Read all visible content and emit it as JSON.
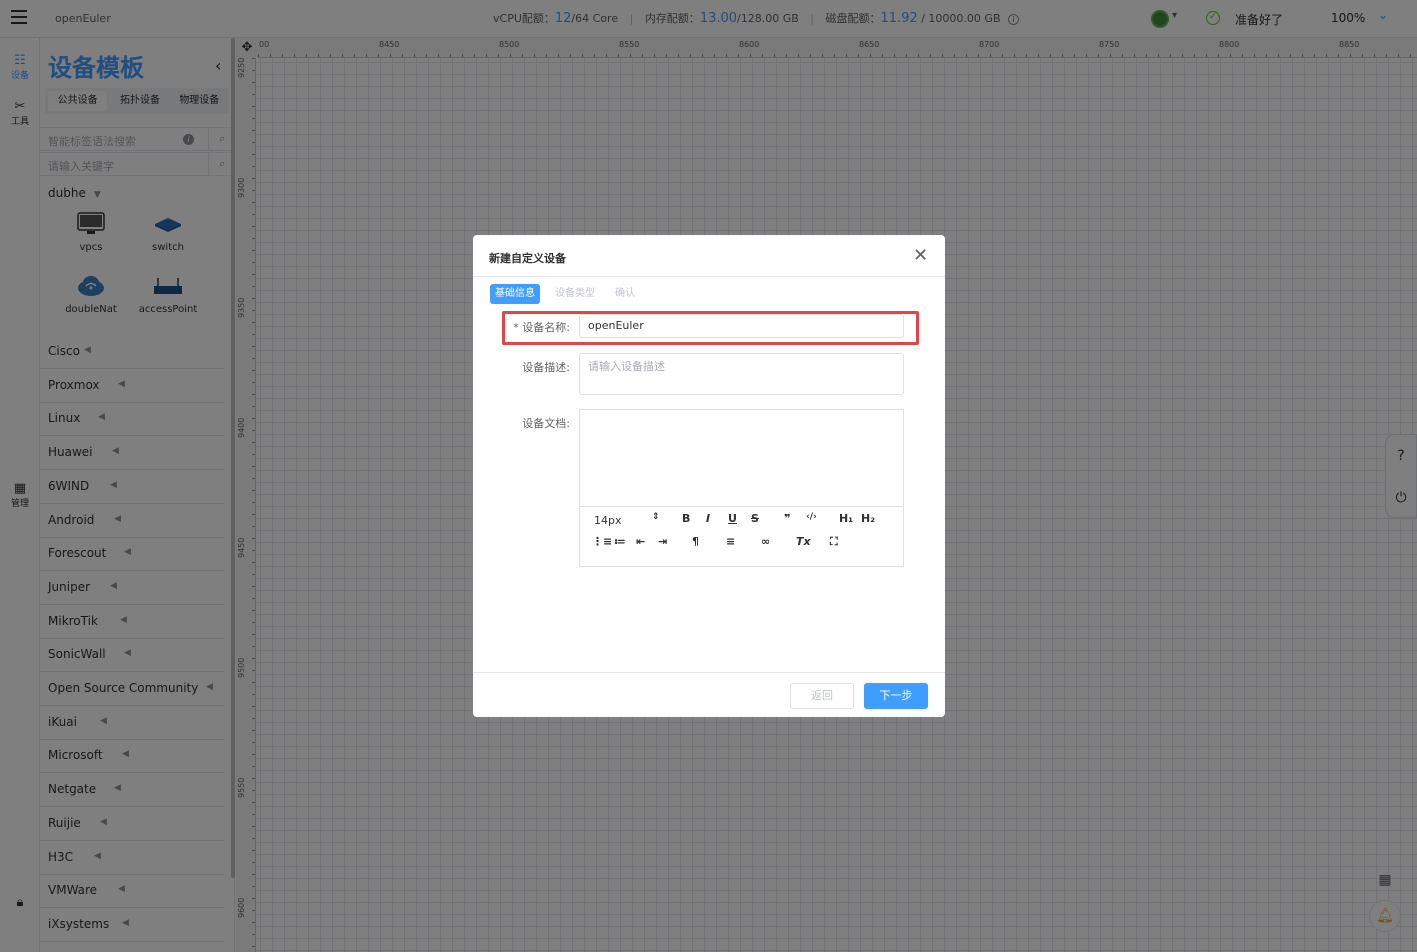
{
  "header": {
    "app_title": "openEuler",
    "vcpu_label": "vCPU配额：",
    "vcpu_used": "12",
    "vcpu_total": "/64 Core",
    "mem_label": "内存配额：",
    "mem_used": "13.00",
    "mem_total": "/128.00 GB",
    "disk_label": "磁盘配额：",
    "disk_used": "11.92",
    "disk_total": " / 10000.00 GB",
    "status_text": "准备好了",
    "zoom": "100%"
  },
  "rail": {
    "devices": "设备",
    "tools": "工具",
    "manage": "管理"
  },
  "sidebar": {
    "title": "设备模板",
    "tabs": [
      "公共设备",
      "拓扑设备",
      "物理设备"
    ],
    "tag_search_placeholder": "智能标签语法搜索",
    "keyword_placeholder": "请输入关键字",
    "group_name": "dubhe",
    "devices": [
      "vpcs",
      "switch",
      "doubleNat",
      "accessPoint"
    ],
    "vendors": [
      "Cisco",
      "Proxmox",
      "Linux",
      "Huawei",
      "6WIND",
      "Android",
      "Forescout",
      "Juniper",
      "MikroTik",
      "SonicWall",
      "Open Source Community",
      "iKuai",
      "Microsoft",
      "Netgate",
      "Ruijie",
      "H3C",
      "VMWare",
      "iXsystems"
    ]
  },
  "ruler": {
    "h_ticks": [
      "00",
      "8450",
      "8500",
      "8550",
      "8600",
      "8650",
      "8700",
      "8750",
      "8800",
      "8850"
    ],
    "v_ticks": [
      "9250",
      "9300",
      "9350",
      "9400",
      "9450",
      "9500",
      "9550",
      "9600"
    ]
  },
  "modal": {
    "title": "新建自定义设备",
    "steps": [
      "基础信息",
      "设备类型",
      "确认"
    ],
    "name_label": "* 设备名称:",
    "name_value": "openEuler",
    "desc_label": "设备描述:",
    "desc_placeholder": "请输入设备描述",
    "doc_label": "设备文档:",
    "font_size": "14px",
    "back_label": "返回",
    "next_label": "下一步"
  }
}
